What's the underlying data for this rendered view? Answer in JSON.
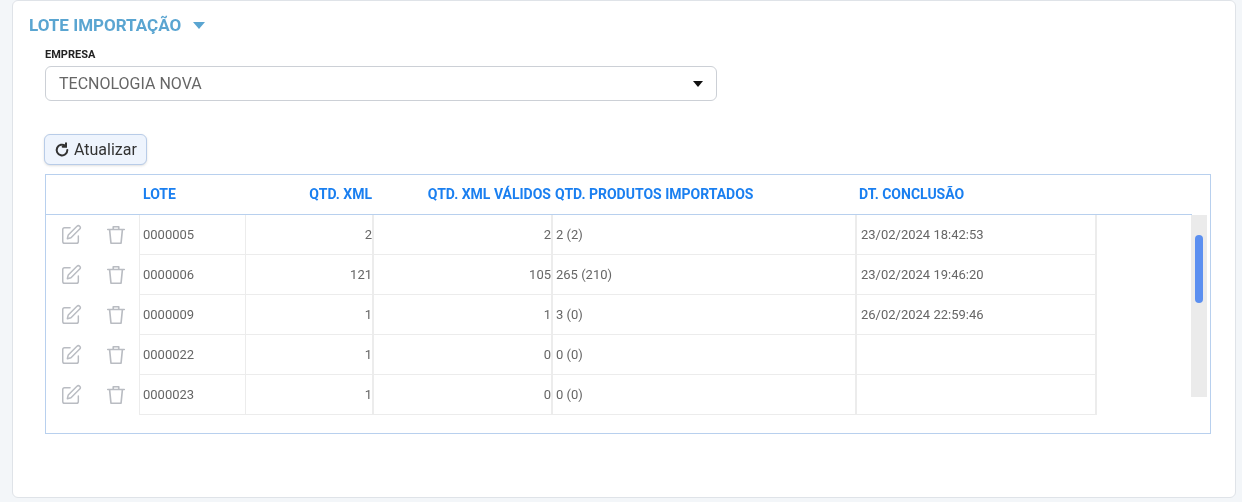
{
  "section": {
    "title": "LOTE IMPORTAÇÃO",
    "expanded": true
  },
  "company_field": {
    "label": "EMPRESA",
    "value": "TECNOLOGIA NOVA"
  },
  "refresh_button": {
    "label": "Atualizar"
  },
  "table": {
    "columns": [
      "LOTE",
      "QTD. XML",
      "QTD. XML VÁLIDOS",
      "QTD. PRODUTOS IMPORTADOS",
      "DT. CONCLUSÃO"
    ],
    "rows": [
      {
        "lote": "0000005",
        "qtd_xml": "2",
        "qtd_validos": "2",
        "qtd_produtos": "2 (2)",
        "dt_conclusao": "23/02/2024 18:42:53"
      },
      {
        "lote": "0000006",
        "qtd_xml": "121",
        "qtd_validos": "105",
        "qtd_produtos": "265 (210)",
        "dt_conclusao": "23/02/2024 19:46:20"
      },
      {
        "lote": "0000009",
        "qtd_xml": "1",
        "qtd_validos": "1",
        "qtd_produtos": "3 (0)",
        "dt_conclusao": "26/02/2024 22:59:46"
      },
      {
        "lote": "0000022",
        "qtd_xml": "1",
        "qtd_validos": "0",
        "qtd_produtos": "0 (0)"
      },
      {
        "lote": "0000023",
        "qtd_xml": "1",
        "qtd_validos": "0",
        "qtd_produtos": "0 (0)"
      }
    ]
  }
}
